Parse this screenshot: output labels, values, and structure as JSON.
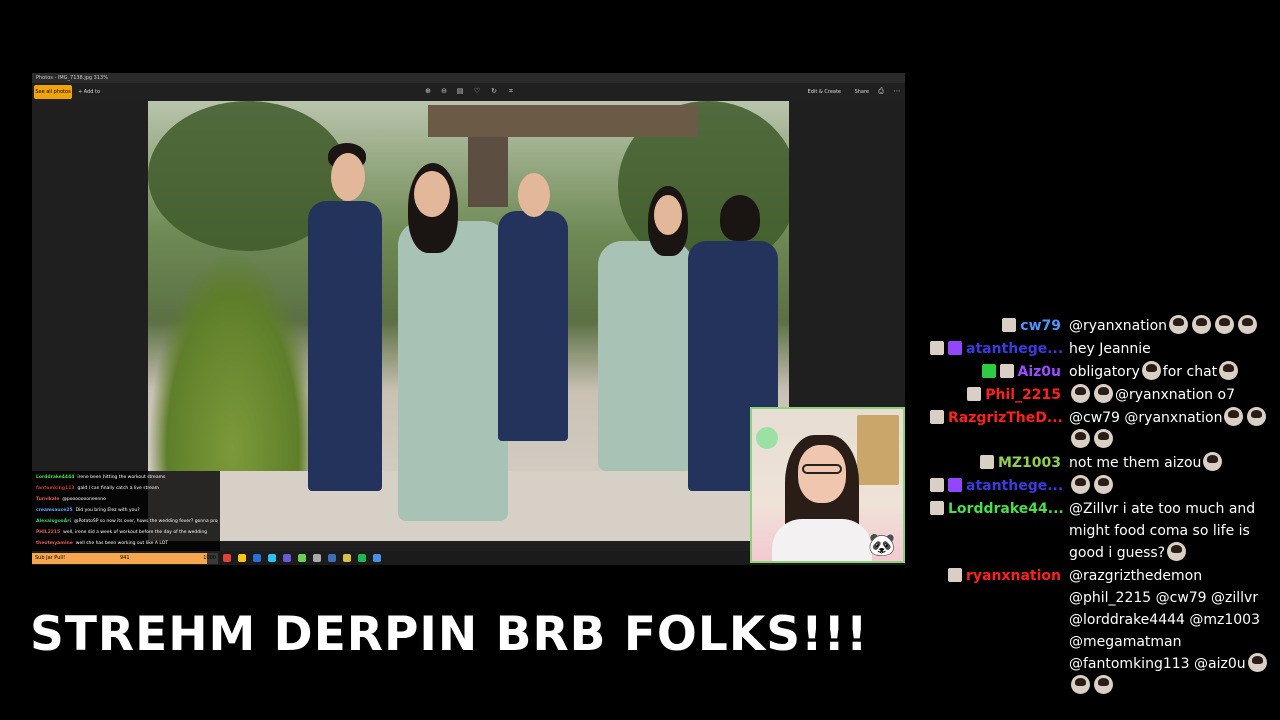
{
  "viewer": {
    "title": "Photos - IMG_7138.jpg   313%",
    "see_all_label": "See all photos",
    "add_to_label": "+ Add to",
    "edit_create_label": "Edit & Create",
    "share_label": "Share"
  },
  "mini_chat": [
    {
      "name": "Lorddrake4444",
      "color": "#4ade4a",
      "text": "irene been hitting the workout streams"
    },
    {
      "name": "fantomking113",
      "color": "#c0392b",
      "text": "gald I can finally catch a live stream"
    },
    {
      "name": "Turnikale",
      "color": "#e05a5a",
      "text": "@poooooooneenne"
    },
    {
      "name": "creamsauce25",
      "color": "#6aa6ff",
      "text": "Did you bring Elez with you?"
    },
    {
      "name": "AlexaIsgooAri",
      "color": "#3ccf6a",
      "text": "@PotatoSP so now its over, hows the wedding fever? gonna propose?"
    },
    {
      "name": "PHIL2215",
      "color": "#e05a5a",
      "text": "well, irene did a week of workout before the day of the wedding"
    },
    {
      "name": "theotmyamine",
      "color": "#e05a5a",
      "text": "well she has been working out like A LOT"
    }
  ],
  "sub_bar": {
    "label": "Sub Jar Pull!",
    "value": "941",
    "goal": "1000",
    "fraction": 0.941
  },
  "brb": {
    "text": "STREHM DERPIN BRB FOLKS!!!"
  },
  "chat": [
    {
      "user": "cw79",
      "color": "#4f94ff",
      "badges": [
        "#d9cfc5"
      ],
      "text": "@ryanxnation",
      "emotes_after": 4
    },
    {
      "user": "atanthege...",
      "color": "#3a3adf",
      "badges": [
        "#d9cfc5",
        "#9146ff"
      ],
      "text": "hey Jeannie",
      "emotes_after": 0
    },
    {
      "user": "Aiz0u",
      "color": "#9a4dff",
      "badges": [
        "#2ecc40",
        "#d9cfc5"
      ],
      "text": "obligatory",
      "emotes_mid": 1,
      "text2": "for chat",
      "emotes_after": 1
    },
    {
      "user": "Phil_2215",
      "color": "#ff2020",
      "badges": [
        "#d9cfc5"
      ],
      "pre_emotes": 2,
      "text": "@ryanxnation o7",
      "emotes_after": 0
    },
    {
      "user": "RazgrizTheD...",
      "color": "#ff2020",
      "badges": [
        "#d9cfc5"
      ],
      "text": "@cw79 @ryanxnation",
      "emotes_after": 2,
      "line2_emotes": 2
    },
    {
      "user": "MZ1003",
      "color": "#8fd14f",
      "badges": [
        "#d9cfc5"
      ],
      "text": "not me them aizou",
      "emotes_after": 1
    },
    {
      "user": "atanthege...",
      "color": "#3a3adf",
      "badges": [
        "#d9cfc5",
        "#9146ff"
      ],
      "pre_emotes": 2,
      "text": "",
      "emotes_after": 0
    },
    {
      "user": "Lorddrake44...",
      "color": "#4ade4a",
      "badges": [
        "#d9cfc5"
      ],
      "lines": [
        "@Zillvr i ate too much and",
        "might food coma so life is",
        "good i guess?"
      ],
      "emotes_after": 1
    },
    {
      "user": "ryanxnation",
      "color": "#ff2020",
      "badges": [
        "#d9cfc5"
      ],
      "lines": [
        "@razgrizthedemon",
        "@phil_2215 @cw79 @zillvr",
        "@lorddrake4444 @mz1003",
        "@megamatman",
        "@fantomking113 @aiz0u"
      ],
      "emotes_after": 1,
      "line_last_emotes": 2
    }
  ]
}
